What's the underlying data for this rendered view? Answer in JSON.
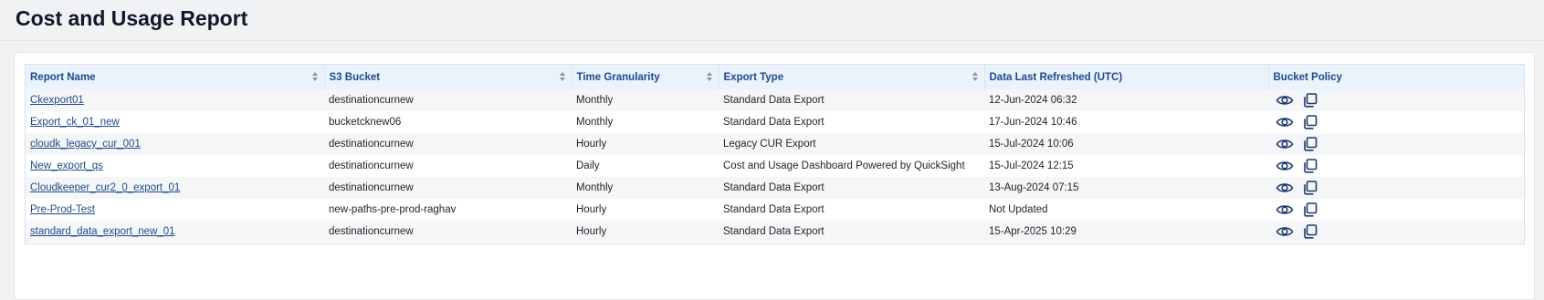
{
  "page": {
    "title": "Cost and Usage Report"
  },
  "table": {
    "headers": {
      "report_name": "Report Name",
      "s3_bucket": "S3 Bucket",
      "time_granularity": "Time Granularity",
      "export_type": "Export Type",
      "data_last_refreshed": "Data Last Refreshed (UTC)",
      "bucket_policy": "Bucket Policy"
    },
    "rows": [
      {
        "report_name": "Ckexport01",
        "s3_bucket": "destinationcurnew",
        "time_granularity": "Monthly",
        "export_type": "Standard Data Export",
        "data_last_refreshed": "12-Jun-2024 06:32"
      },
      {
        "report_name": "Export_ck_01_new",
        "s3_bucket": "bucketcknew06",
        "time_granularity": "Monthly",
        "export_type": "Standard Data Export",
        "data_last_refreshed": "17-Jun-2024 10:46"
      },
      {
        "report_name": "cloudk_legacy_cur_001",
        "s3_bucket": "destinationcurnew",
        "time_granularity": "Hourly",
        "export_type": "Legacy CUR Export",
        "data_last_refreshed": "15-Jul-2024 10:06"
      },
      {
        "report_name": "New_export_qs",
        "s3_bucket": "destinationcurnew",
        "time_granularity": "Daily",
        "export_type": "Cost and Usage Dashboard Powered by QuickSight",
        "data_last_refreshed": "15-Jul-2024 12:15"
      },
      {
        "report_name": "Cloudkeeper_cur2_0_export_01",
        "s3_bucket": "destinationcurnew",
        "time_granularity": "Monthly",
        "export_type": "Standard Data Export",
        "data_last_refreshed": "13-Aug-2024 07:15"
      },
      {
        "report_name": "Pre-Prod-Test",
        "s3_bucket": "new-paths-pre-prod-raghav",
        "time_granularity": "Hourly",
        "export_type": "Standard Data Export",
        "data_last_refreshed": "Not Updated"
      },
      {
        "report_name": "standard_data_export_new_01",
        "s3_bucket": "destinationcurnew",
        "time_granularity": "Hourly",
        "export_type": "Standard Data Export",
        "data_last_refreshed": "15-Apr-2025 10:29"
      }
    ],
    "row_icons": [
      "eye-icon",
      "copy-icon"
    ]
  },
  "colors": {
    "header_bg": "#eaf2fb",
    "header_text": "#1e4a8a",
    "link": "#1e4a8a",
    "icon": "#1e3a6e"
  }
}
